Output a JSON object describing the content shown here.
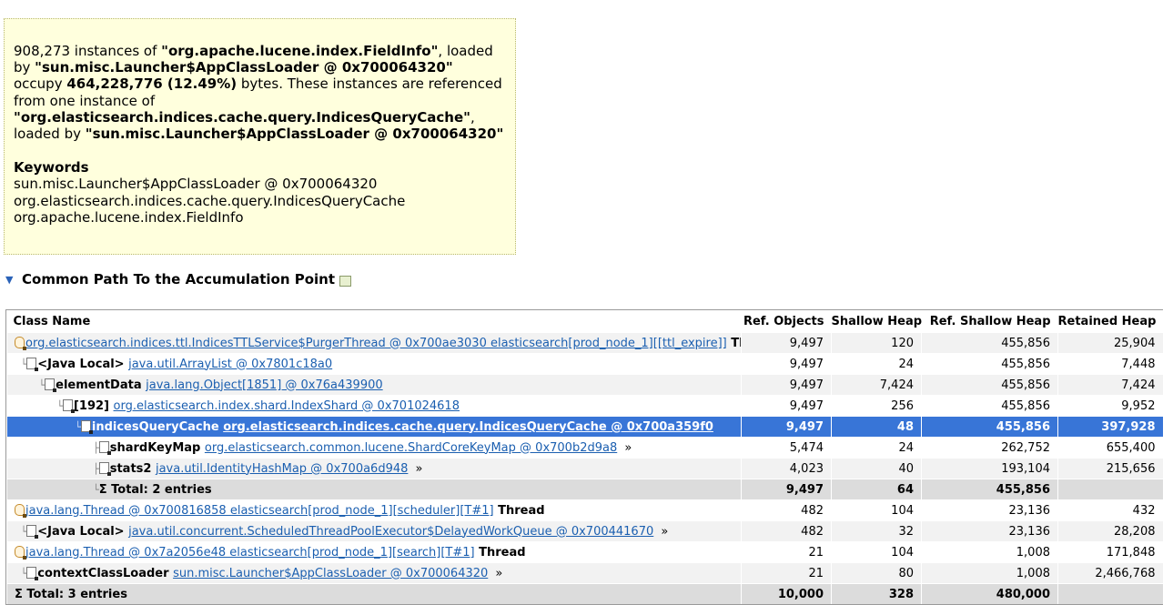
{
  "summary": {
    "count": "908,273",
    "t_instances_of": " instances of ",
    "class_quoted": "\"org.apache.lucene.index.FieldInfo\"",
    "t_loaded_by": ", loaded by ",
    "loader_quoted": "\"sun.misc.Launcher$AppClassLoader @ 0x700064320\"",
    "t_occupy": " occupy ",
    "size": "464,228,776 (12.49%)",
    "t_bytes": " bytes. These instances are referenced from one instance of ",
    "ref_class_quoted": "\"org.elasticsearch.indices.cache.query.IndicesQueryCache\"",
    "t_loaded_by2": ", loaded by ",
    "ref_loader_quoted": "\"sun.misc.Launcher$AppClassLoader @ 0x700064320\"",
    "keywords_title": "Keywords",
    "keywords": [
      "sun.misc.Launcher$AppClassLoader @ 0x700064320",
      "org.elasticsearch.indices.cache.query.IndicesQueryCache",
      "org.apache.lucene.index.FieldInfo"
    ]
  },
  "section": {
    "title": "Common Path To the Accumulation Point",
    "expanded_icon": "chevron-down-icon",
    "export_icon": "section-export-icon"
  },
  "table": {
    "columns": {
      "class_name": "Class Name",
      "ref_objects": "Ref. Objects",
      "shallow_heap": "Shallow Heap",
      "ref_shallow_heap": "Ref. Shallow Heap",
      "retained_heap": "Retained Heap"
    },
    "rows": [
      {
        "prefix": "",
        "link": "org.elasticsearch.indices.ttl.IndicesTTLService$PurgerThread @ 0x700ae3030 elasticsearch[prod_node_1][[ttl_expire]]",
        "suffix": " Thread",
        "ref_objects": "9,497",
        "shallow": "120",
        "ref_shallow": "455,856",
        "retained": "25,904"
      },
      {
        "prefix": "<Java Local> ",
        "link": "java.util.ArrayList @ 0x7801c18a0",
        "suffix": "",
        "ref_objects": "9,497",
        "shallow": "24",
        "ref_shallow": "455,856",
        "retained": "7,448"
      },
      {
        "prefix": "elementData ",
        "link": "java.lang.Object[1851] @ 0x76a439900",
        "suffix": "",
        "ref_objects": "9,497",
        "shallow": "7,424",
        "ref_shallow": "455,856",
        "retained": "7,424"
      },
      {
        "prefix": "[192] ",
        "link": "org.elasticsearch.index.shard.IndexShard @ 0x701024618",
        "suffix": "",
        "ref_objects": "9,497",
        "shallow": "256",
        "ref_shallow": "455,856",
        "retained": "9,952"
      },
      {
        "prefix": "indicesQueryCache ",
        "link": "org.elasticsearch.indices.cache.query.IndicesQueryCache @ 0x700a359f0",
        "suffix": "",
        "ref_objects": "9,497",
        "shallow": "48",
        "ref_shallow": "455,856",
        "retained": "397,928"
      },
      {
        "prefix": "shardKeyMap ",
        "link": "org.elasticsearch.common.lucene.ShardCoreKeyMap @ 0x700b2d9a8",
        "suffix": " »",
        "ref_objects": "5,474",
        "shallow": "24",
        "ref_shallow": "262,752",
        "retained": "655,400"
      },
      {
        "prefix": "stats2 ",
        "link": "java.util.IdentityHashMap @ 0x700a6d948",
        "suffix": " »",
        "ref_objects": "4,023",
        "shallow": "40",
        "ref_shallow": "193,104",
        "retained": "215,656"
      },
      {
        "prefix": "Σ Total: 2 entries",
        "link": "",
        "suffix": "",
        "ref_objects": "9,497",
        "shallow": "64",
        "ref_shallow": "455,856",
        "retained": ""
      },
      {
        "prefix": "",
        "link": "java.lang.Thread @ 0x700816858 elasticsearch[prod_node_1][scheduler][T#1]",
        "suffix": " Thread",
        "ref_objects": "482",
        "shallow": "104",
        "ref_shallow": "23,136",
        "retained": "432"
      },
      {
        "prefix": "<Java Local> ",
        "link": "java.util.concurrent.ScheduledThreadPoolExecutor$DelayedWorkQueue @ 0x700441670",
        "suffix": " »",
        "ref_objects": "482",
        "shallow": "32",
        "ref_shallow": "23,136",
        "retained": "28,208"
      },
      {
        "prefix": "",
        "link": "java.lang.Thread @ 0x7a2056e48 elasticsearch[prod_node_1][search][T#1]",
        "suffix": " Thread",
        "ref_objects": "21",
        "shallow": "104",
        "ref_shallow": "1,008",
        "retained": "171,848"
      },
      {
        "prefix": "contextClassLoader ",
        "link": "sun.misc.Launcher$AppClassLoader @ 0x700064320",
        "suffix": " »",
        "ref_objects": "21",
        "shallow": "80",
        "ref_shallow": "1,008",
        "retained": "2,466,768"
      },
      {
        "prefix": "Σ Total: 3 entries",
        "link": "",
        "suffix": "",
        "ref_objects": "10,000",
        "shallow": "328",
        "ref_shallow": "480,000",
        "retained": ""
      }
    ]
  }
}
